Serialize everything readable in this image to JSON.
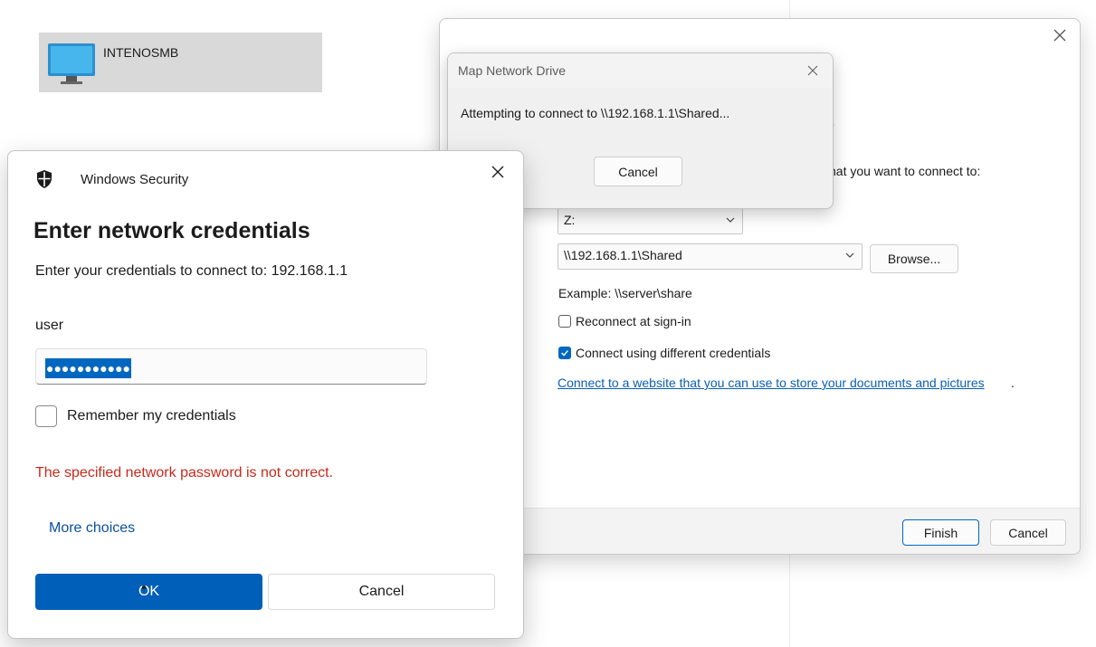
{
  "explorer": {
    "computer_name": "INTENOSMB"
  },
  "wizard": {
    "partial_link": "?",
    "instruction_partial": "hat you want to connect to:",
    "folder_label_partial": ":",
    "drive_value": "Z:",
    "folder_value": "\\\\192.168.1.1\\Shared",
    "browse_label": "Browse...",
    "example_text": "Example: \\\\server\\share",
    "reconnect_label": "Reconnect at sign-in",
    "reconnect_checked": false,
    "different_creds_label": "Connect using different credentials",
    "different_creds_checked": true,
    "website_link": "Connect to a website that you can use to store your documents and pictures",
    "website_period": ".",
    "finish_label": "Finish",
    "cancel_label": "Cancel"
  },
  "progress_dialog": {
    "title": "Map Network Drive",
    "message": "Attempting to connect to \\\\192.168.1.1\\Shared...",
    "cancel_label": "Cancel"
  },
  "security_dialog": {
    "app_name": "Windows Security",
    "heading": "Enter network credentials",
    "subtitle": "Enter your credentials to connect to: 192.168.1.1",
    "username": "user",
    "password_mask": "●●●●●●●●●●●",
    "password_placeholder": "",
    "remember_label": "Remember my credentials",
    "remember_checked": false,
    "error_message": "The specified network password is not correct.",
    "more_choices": "More choices",
    "ok_label": "OK",
    "cancel_label": "Cancel"
  },
  "colors": {
    "accent": "#005fb8",
    "error": "#c42b1c",
    "link": "#0a5fb4"
  }
}
